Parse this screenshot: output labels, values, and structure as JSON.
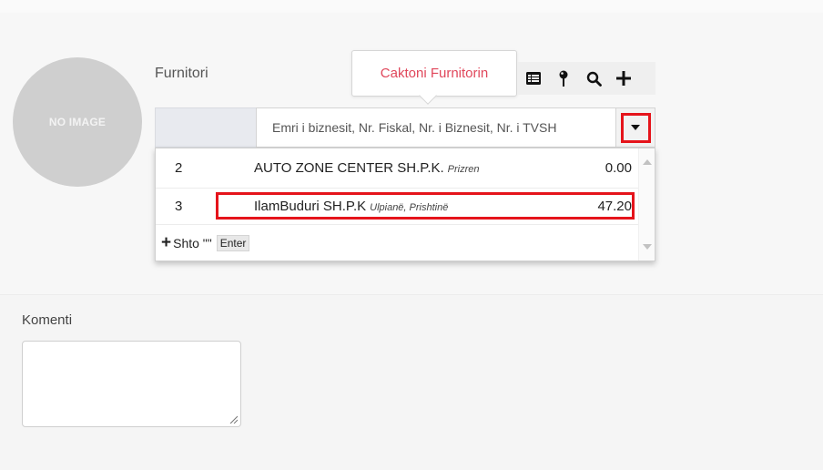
{
  "avatar": {
    "placeholder": "NO IMAGE"
  },
  "supplier": {
    "label": "Furnitori",
    "tooltip": "Caktoni Furnitorin",
    "search_placeholder": "Emri i biznesit, Nr. Fiskal, Nr. i Biznesit, Nr. i TVSH",
    "toolbar_icons": [
      "list-icon",
      "map-pin-icon",
      "search-icon",
      "plus-icon"
    ],
    "dropdown_icon": "caret-down-icon"
  },
  "results": [
    {
      "num": "2",
      "name": "AUTO ZONE CENTER SH.P.K.",
      "city": "Prizren",
      "amount": "0.00"
    },
    {
      "num": "3",
      "name": "IlamBuduri SH.P.K",
      "city": "Ulpianë, Prishtinë",
      "amount": "47.20"
    }
  ],
  "add_option": {
    "text": "Shto \"\"",
    "key": "Enter"
  },
  "comment": {
    "label": "Komenti",
    "value": ""
  },
  "colors": {
    "highlight": "#e5141b",
    "tooltip_text": "#e0475b"
  }
}
